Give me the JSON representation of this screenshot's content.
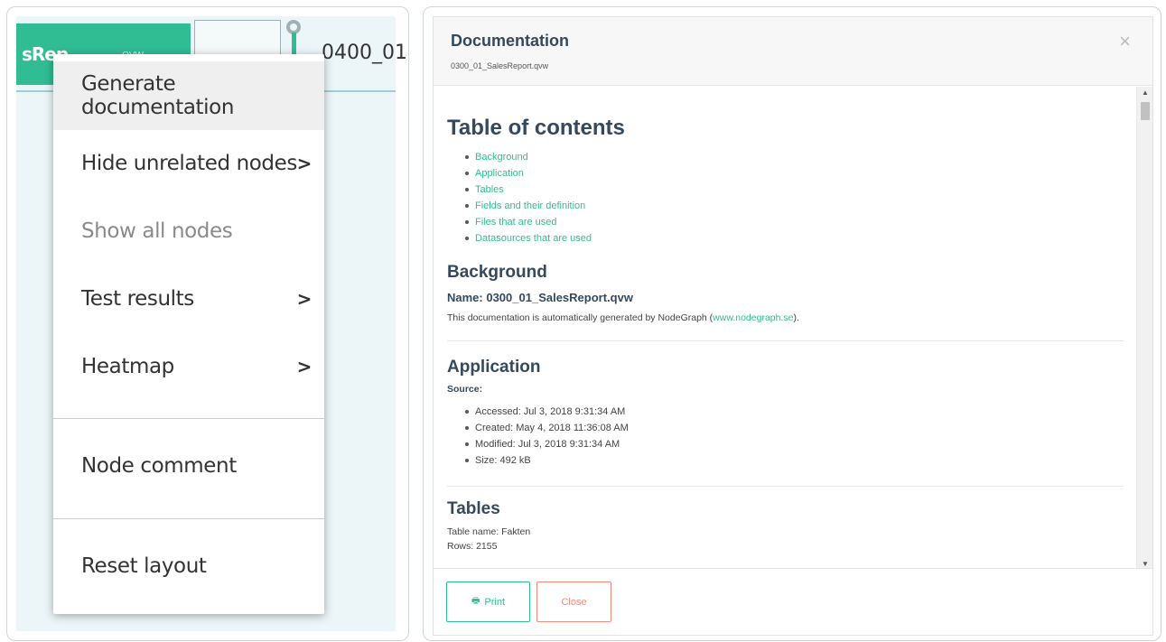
{
  "graph": {
    "node_label": "sRep",
    "node_tag": "QVW",
    "node_id_label": "0400_01"
  },
  "context_menu": {
    "items": [
      {
        "label": "Generate documentation"
      },
      {
        "label": "Hide unrelated nodes",
        "chevron": ">"
      },
      {
        "label": "Show all nodes"
      },
      {
        "label": "Test results",
        "chevron": ">"
      },
      {
        "label": "Heatmap",
        "chevron": ">"
      },
      {
        "label": "Node comment"
      },
      {
        "label": "Reset layout"
      }
    ]
  },
  "modal": {
    "title": "Documentation",
    "subtitle": "0300_01_SalesReport.qvw",
    "close_glyph": "×",
    "toc": {
      "title": "Table of contents",
      "items": [
        "Background",
        "Application",
        "Tables",
        "Fields and their definition",
        "Files that are used",
        "Datasources that are used"
      ]
    },
    "background": {
      "title": "Background",
      "name_line": "Name: 0300_01_SalesReport.qvw",
      "text_before": "This documentation is automatically generated by NodeGraph (",
      "link": "www.nodegraph.se",
      "text_after": ")."
    },
    "application": {
      "title": "Application",
      "source_label": "Source:",
      "items": [
        "Accessed: Jul 3, 2018 9:31:34 AM",
        "Created: May 4, 2018 11:36:08 AM",
        "Modified: Jul 3, 2018 9:31:34 AM",
        "Size: 492 kB"
      ]
    },
    "tables": {
      "title": "Tables",
      "table_name": "Table name: Fakten",
      "rows": "Rows: 2155"
    },
    "footer": {
      "print_label": "Print",
      "close_label": "Close"
    }
  },
  "colors": {
    "accent": "#30bd94",
    "heading": "#34495e",
    "danger": "#f08b7a"
  }
}
